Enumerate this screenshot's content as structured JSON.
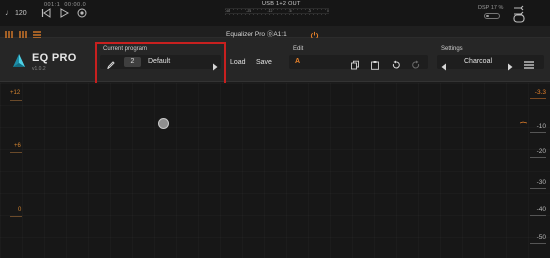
{
  "topbar": {
    "tempo_value": "120",
    "timecode_bars": "001:1",
    "timecode_time": "00:00.0",
    "meter_title": "USB 1+2 OUT",
    "meter_scale": [
      "-48",
      "-24",
      "-12",
      "-6",
      "-3",
      "0"
    ],
    "dsp_label": "DSP",
    "dsp_value": "17 %"
  },
  "titlebar": {
    "plugin_name": "Equalizer Pro ⓪A1:1"
  },
  "brand": {
    "name": "EQ PRO",
    "version": "v1.0.2"
  },
  "program": {
    "section_label": "Current program",
    "number": "2",
    "name": "Default",
    "load_label": "Load",
    "save_label": "Save"
  },
  "edit": {
    "section_label": "Edit",
    "ab_label": "A"
  },
  "settings": {
    "section_label": "Settings",
    "skin_name": "Charcoal"
  },
  "graph": {
    "left_labels": [
      "+12",
      "+6",
      "0"
    ],
    "right_labels": [
      "-3.3",
      "-10",
      "-20",
      "-30",
      "-40",
      "-50"
    ]
  },
  "colors": {
    "accent_orange": "#e8822a",
    "highlight_red": "#c8201f",
    "background": "#1b1b1b"
  }
}
